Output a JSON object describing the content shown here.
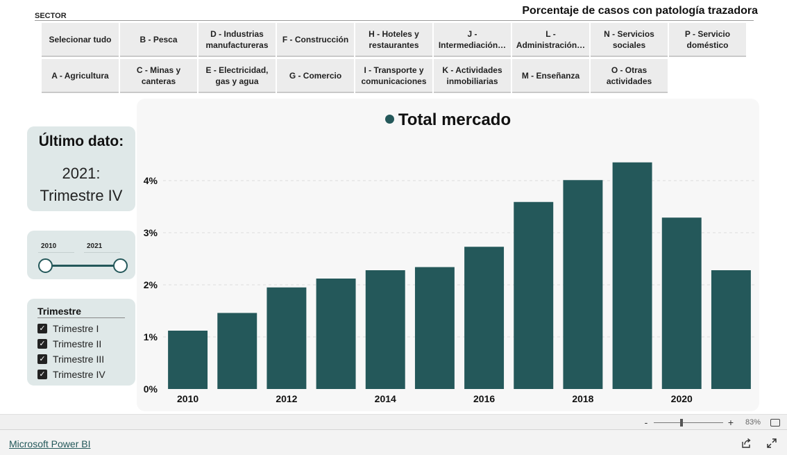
{
  "header": {
    "sector_label": "SECTOR",
    "page_title": "Porcentaje de casos con patología trazadora"
  },
  "sector_slicer": {
    "row1": [
      "Selecionar tudo",
      "B - Pesca",
      "D - Industrias manufactureras",
      "F - Construcción",
      "H - Hoteles y restaurantes",
      "J - Intermediación…",
      "L - Administración…",
      "N - Servicios sociales",
      "P - Servicio doméstico"
    ],
    "row2": [
      "A - Agricultura",
      "C - Minas y canteras",
      "E - Electricidad, gas y agua",
      "G - Comercio",
      "I - Transporte y comunicaciones",
      "K - Actividades inmobiliarias",
      "M - Enseñanza",
      "O - Otras actividades"
    ]
  },
  "ultimo_dato": {
    "title": "Último dato:",
    "year": "2021:",
    "quarter": "Trimestre IV"
  },
  "year_range": {
    "start_label": "2010",
    "end_label": "2021",
    "start": 2010,
    "end": 2021
  },
  "trimestre_filter": {
    "title": "Trimestre",
    "items": [
      "Trimestre I",
      "Trimestre II",
      "Trimestre III",
      "Trimestre IV"
    ],
    "checked": [
      true,
      true,
      true,
      true
    ]
  },
  "chart_data": {
    "type": "bar",
    "title": "Total mercado",
    "series": [
      {
        "values": [
          1.12,
          1.46,
          1.95,
          2.12,
          2.28,
          2.34,
          2.73,
          3.59,
          4.01,
          4.35,
          3.29,
          2.28
        ]
      }
    ],
    "categories": [
      "2010",
      "2011",
      "2012",
      "2013",
      "2014",
      "2015",
      "2016",
      "2017",
      "2018",
      "2019",
      "2020",
      "2021"
    ],
    "x_tick_labels": [
      "2010",
      "2012",
      "2014",
      "2016",
      "2018",
      "2020"
    ],
    "y_tick_labels": [
      "0%",
      "1%",
      "2%",
      "3%",
      "4%"
    ],
    "ylim": [
      0,
      4.6
    ],
    "grid": true,
    "bar_color": "#24585a"
  },
  "footer": {
    "zoom_minus": "-",
    "zoom_plus": "+",
    "zoom_level": "83%",
    "powerbi_link": "Microsoft Power BI"
  }
}
